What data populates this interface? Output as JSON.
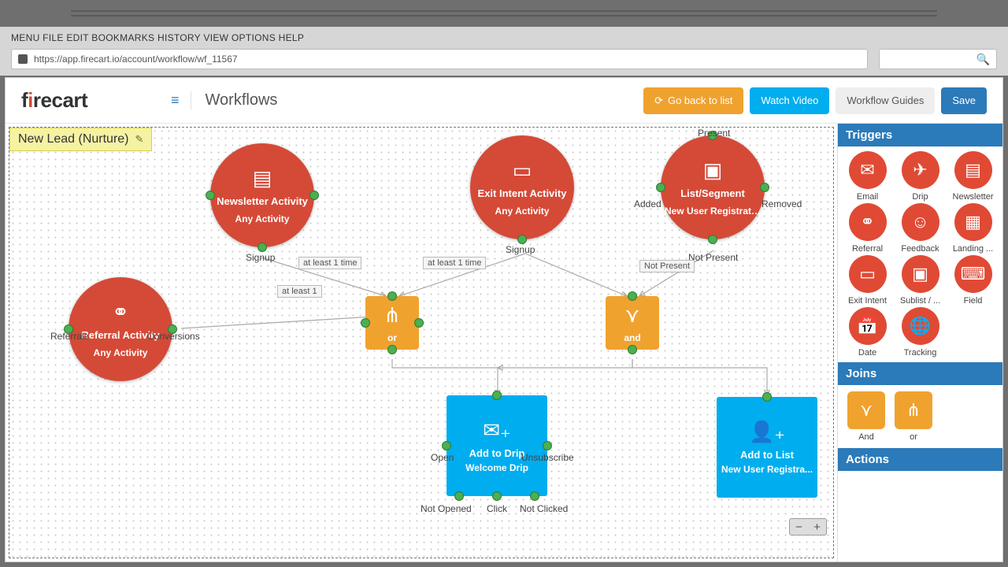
{
  "browser": {
    "menus": "MENU FILE EDIT BOOKMARKS HISTORY VIEW OPTIONS HELP",
    "url": "https://app.firecart.io/account/workflow/wf_11567"
  },
  "header": {
    "logo": "firecart",
    "page": "Workflows",
    "back": "Go back to list",
    "watch": "Watch Video",
    "guides": "Workflow Guides",
    "save": "Save"
  },
  "canvas": {
    "title": "New Lead (Nurture)",
    "zoom_minus": "−",
    "zoom_plus": "+"
  },
  "nodes": {
    "newsletter": {
      "title": "Newsletter Activity",
      "sub": "Any Activity",
      "out1": "Signup"
    },
    "exit": {
      "title": "Exit Intent Activity",
      "sub": "Any Activity",
      "out1": "Signup"
    },
    "list": {
      "title": "List/Segment",
      "sub": "New User Registrat…",
      "l": "Added",
      "r": "Removed",
      "t": "Present",
      "b": "Not Present"
    },
    "referral": {
      "title": "Referral Activity",
      "sub": "Any Activity",
      "l": "Referrals",
      "r": "Conversions"
    },
    "or": {
      "label": "or"
    },
    "and": {
      "label": "and"
    },
    "drip": {
      "title": "Add to Drip",
      "sub": "Welcome Drip",
      "l": "Open",
      "r": "Unsubscribe",
      "b1": "Not Opened",
      "b2": "Click",
      "b3": "Not Clicked"
    },
    "addlist": {
      "title": "Add to List",
      "sub": "New User Registra..."
    }
  },
  "edges": {
    "atleast1a": "at least 1 time",
    "atleast1b": "at least 1 time",
    "atleast1c": "at least 1",
    "notpresent": "Not Present"
  },
  "sidebar": {
    "triggers": "Triggers",
    "joins": "Joins",
    "actions": "Actions",
    "tiles": {
      "email": "Email",
      "drip": "Drip",
      "newsletter": "Newsletter",
      "referral": "Referral",
      "feedback": "Feedback",
      "landing": "Landing ...",
      "exit": "Exit Intent",
      "sublist": "Sublist / ...",
      "field": "Field",
      "date": "Date",
      "tracking": "Tracking",
      "and": "And",
      "or": "or"
    }
  }
}
